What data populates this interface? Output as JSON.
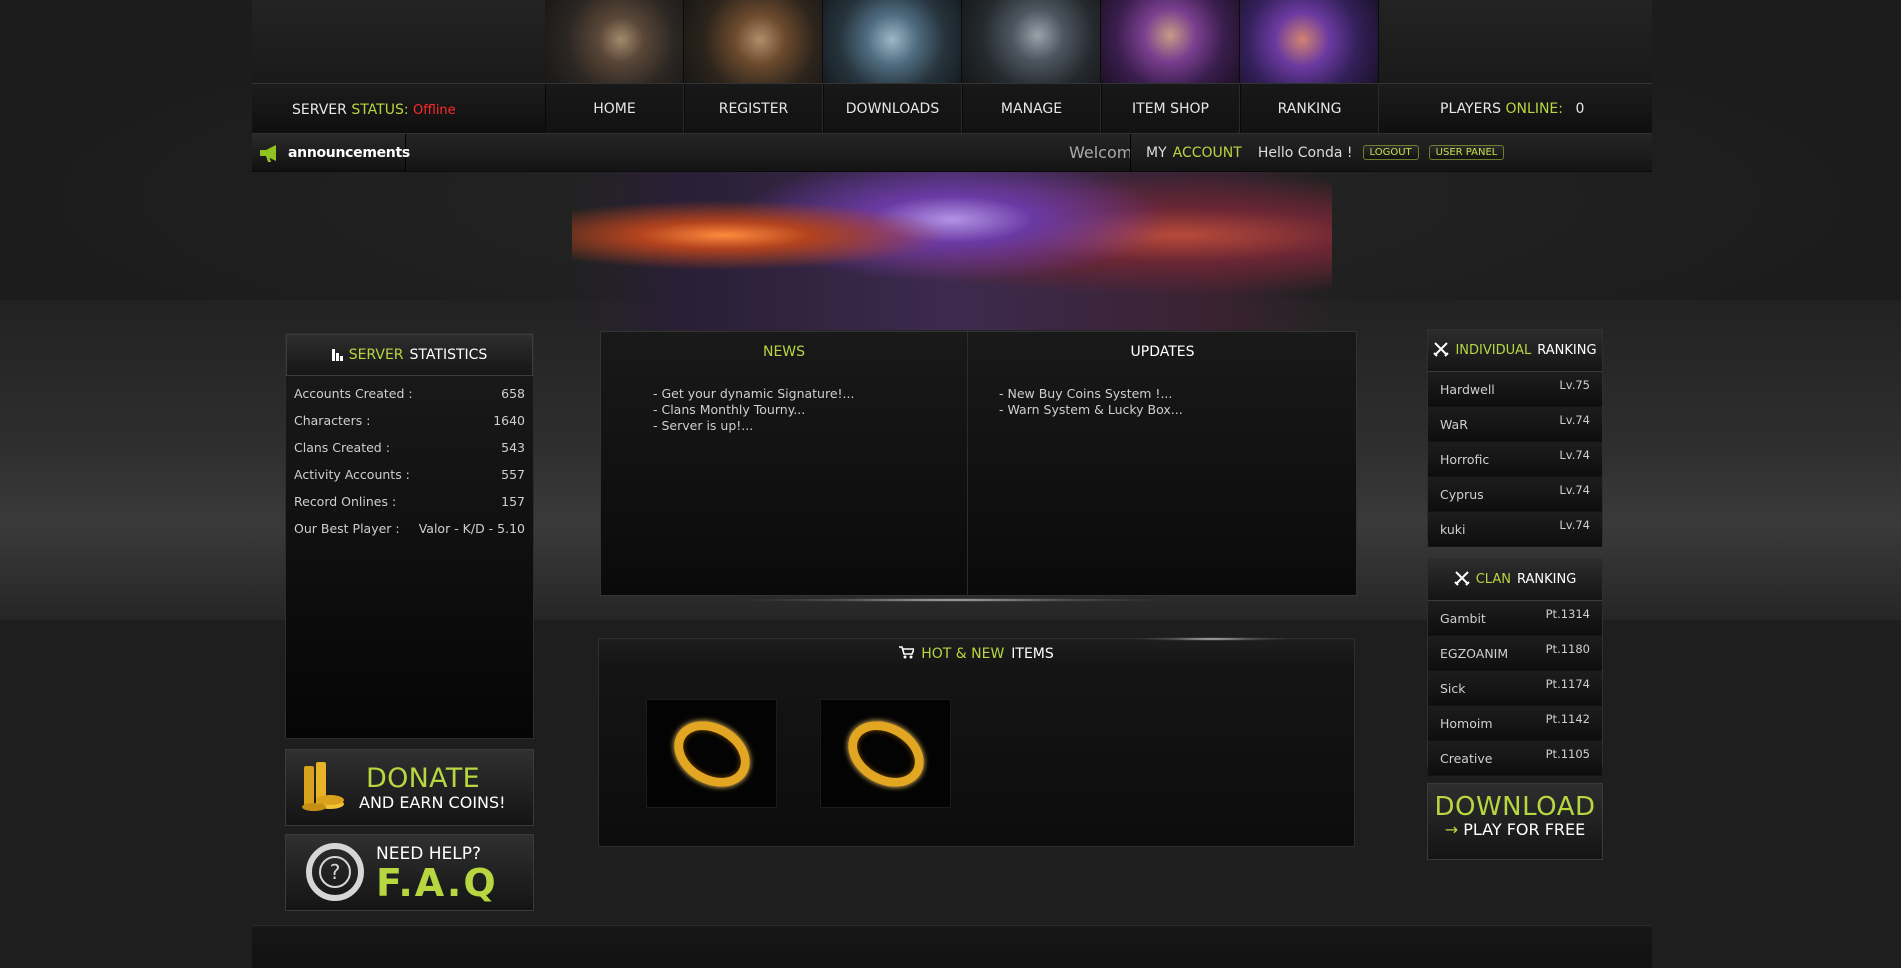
{
  "header": {
    "server_label_1": "SERVER",
    "server_label_2": "STATUS:",
    "server_status": "Offline",
    "nav": [
      "HOME",
      "REGISTER",
      "DOWNLOADS",
      "MANAGE",
      "ITEM SHOP",
      "RANKING"
    ],
    "players_label_1": "PLAYERS",
    "players_label_2": "ONLINE:",
    "players_online": "0"
  },
  "announce": {
    "label": "announcements",
    "welcome": "Welcom",
    "my": "MY",
    "account": "ACCOUNT",
    "hello": "Hello Conda !",
    "logout": "LOGOUT",
    "user_panel": "USER PANEL"
  },
  "stats": {
    "title_1": "SERVER",
    "title_2": "STATISTICS",
    "rows": [
      {
        "label": "Accounts Created :",
        "value": "658"
      },
      {
        "label": "Characters :",
        "value": "1640"
      },
      {
        "label": "Clans Created :",
        "value": "543"
      },
      {
        "label": "Activity Accounts :",
        "value": "557"
      },
      {
        "label": "Record Onlines :",
        "value": "157"
      },
      {
        "label": "Our Best Player :",
        "value": "Valor - K/D - 5.10"
      }
    ]
  },
  "donate": {
    "line1": "DONATE",
    "line2": "AND EARN COINS!"
  },
  "faq": {
    "line1": "NEED HELP?",
    "line2": "F.A.Q"
  },
  "news": {
    "title": "NEWS",
    "items": [
      "- Get your dynamic Signature!...",
      "- Clans Monthly Tourny...",
      "- Server is up!..."
    ]
  },
  "updates": {
    "title": "UPDATES",
    "items": [
      "- New Buy Coins System !...",
      "- Warn System & Lucky Box..."
    ]
  },
  "hot": {
    "title_1": "HOT & NEW",
    "title_2": "ITEMS"
  },
  "individual_ranking": {
    "title_1": "INDIVIDUAL",
    "title_2": "RANKING",
    "rows": [
      {
        "name": "Hardwell",
        "value": "Lv.75"
      },
      {
        "name": "WaR",
        "value": "Lv.74"
      },
      {
        "name": "Horrofic",
        "value": "Lv.74"
      },
      {
        "name": "Cyprus",
        "value": "Lv.74"
      },
      {
        "name": "kuki",
        "value": "Lv.74"
      }
    ]
  },
  "clan_ranking": {
    "title_1": "CLAN",
    "title_2": "RANKING",
    "rows": [
      {
        "name": "Gambit",
        "value": "Pt.1314"
      },
      {
        "name": "EGZOANIM",
        "value": "Pt.1180"
      },
      {
        "name": "Sick",
        "value": "Pt.1174"
      },
      {
        "name": "Homoim",
        "value": "Pt.1142"
      },
      {
        "name": "Creative",
        "value": "Pt.1105"
      }
    ]
  },
  "download": {
    "line1": "DOWNLOAD",
    "arrow": "→",
    "line2": "PLAY FOR FREE"
  },
  "colors": {
    "accent": "#b8d640",
    "offline": "#ff2a2a",
    "background": "#1e1e1e"
  }
}
